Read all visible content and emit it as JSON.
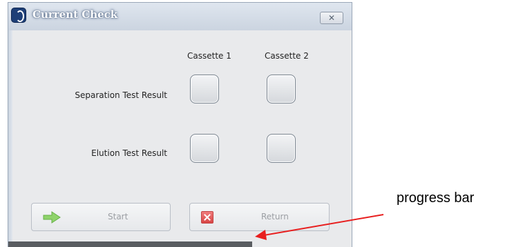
{
  "window": {
    "title": "Current Check",
    "close_glyph": "✕"
  },
  "columns": [
    "Cassette 1",
    "Cassette 2"
  ],
  "rows": [
    {
      "label": "Separation Test Result"
    },
    {
      "label": "Elution Test Result"
    }
  ],
  "buttons": {
    "start_label": "Start",
    "return_label": "Return",
    "start_icon": "green-arrow-right-icon",
    "return_icon": "red-x-icon"
  },
  "progress": {
    "fraction_filled": 0.71
  },
  "annotation": {
    "text": "progress bar",
    "arrow_color": "#e81f1f"
  },
  "colors": {
    "title_text": "#ffffff",
    "progress_fill": "#5a5d61",
    "disabled_text": "#9b9ea3"
  }
}
